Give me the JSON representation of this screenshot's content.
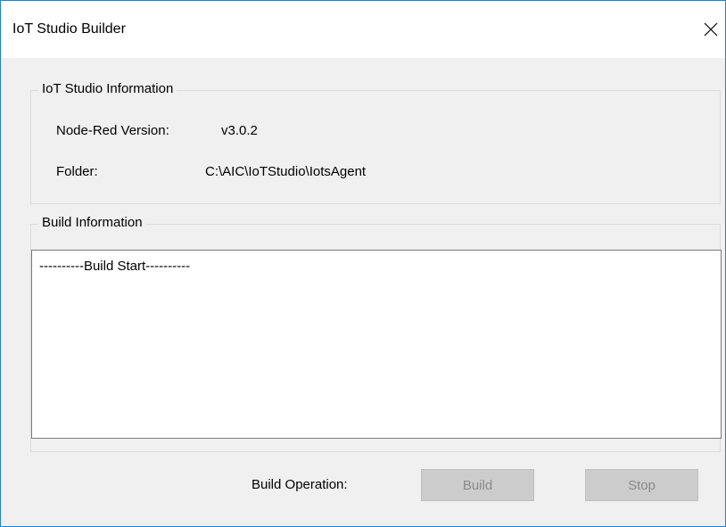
{
  "window": {
    "title": "IoT Studio Builder"
  },
  "info_group": {
    "legend": "IoT Studio Information",
    "rows": [
      {
        "label": "Node-Red Version:",
        "value": "v3.0.2"
      },
      {
        "label": "Folder:",
        "value": "C:\\AIC\\IoTStudio\\IotsAgent"
      }
    ]
  },
  "build_group": {
    "legend": "Build Information",
    "log_text": "----------Build Start----------"
  },
  "operation": {
    "label": "Build Operation:",
    "build_label": "Build",
    "stop_label": "Stop",
    "build_enabled": false,
    "stop_enabled": false
  },
  "icons": {
    "close": "close-icon"
  },
  "colors": {
    "window_border": "#1883d7",
    "disabled_button": "#cccccc",
    "disabled_text": "#8a8a8a"
  }
}
